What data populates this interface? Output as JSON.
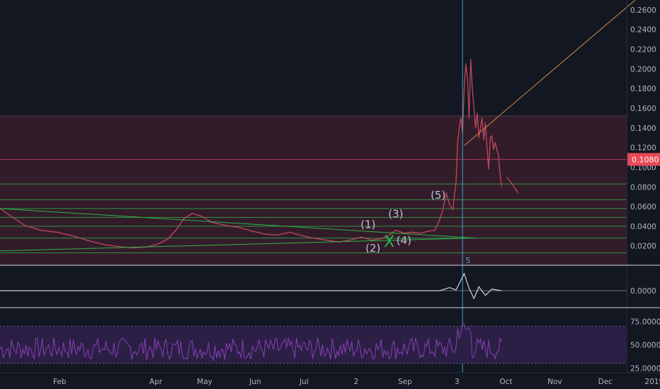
{
  "colors": {
    "background": "#131722",
    "axis_text": "#b2b5be",
    "price_line": "#c2485e",
    "last_price_label_bg": "#e84855",
    "green_lines": "#2eb24a",
    "trend_line": "#c98a4a",
    "vertical_marker": "#3fa2c6",
    "rsi_band": "#2b1f45",
    "rsi_line": "#8a3fb8",
    "resistance_zone": "#3a1d2b"
  },
  "chart_data": [
    {
      "type": "line",
      "panel": "price",
      "ylim": [
        0.004,
        0.27
      ],
      "ytick_labels": [
        "0.2600",
        "0.2400",
        "0.2200",
        "0.2000",
        "0.1800",
        "0.1600",
        "0.1400",
        "0.1200",
        "0.1000",
        "0.0800",
        "0.0600",
        "0.0400",
        "0.0200"
      ],
      "ytick_values": [
        0.26,
        0.24,
        0.22,
        0.2,
        0.18,
        0.16,
        0.14,
        0.12,
        0.1,
        0.08,
        0.06,
        0.04,
        0.02
      ],
      "last_price_label": "0.1080",
      "last_price": 0.108,
      "xtick_labels": [
        "Feb",
        "Apr",
        "May",
        "Jun",
        "Jul",
        "2",
        "Sep",
        "3",
        "Oct",
        "Nov",
        "Dec",
        "2019",
        "Feb"
      ],
      "xtick_days": [
        31,
        90,
        120,
        151,
        181,
        213,
        243,
        275,
        305,
        335,
        366,
        396,
        427
      ],
      "series": [
        {
          "points": [
            {
              "x": 0,
              "y": 0.058
            },
            {
              "x": 8,
              "y": 0.049
            },
            {
              "x": 15,
              "y": 0.041
            },
            {
              "x": 25,
              "y": 0.036
            },
            {
              "x": 35,
              "y": 0.034
            },
            {
              "x": 45,
              "y": 0.03
            },
            {
              "x": 55,
              "y": 0.025
            },
            {
              "x": 65,
              "y": 0.021
            },
            {
              "x": 75,
              "y": 0.019
            },
            {
              "x": 82,
              "y": 0.018
            },
            {
              "x": 90,
              "y": 0.019
            },
            {
              "x": 97,
              "y": 0.022
            },
            {
              "x": 103,
              "y": 0.027
            },
            {
              "x": 108,
              "y": 0.036
            },
            {
              "x": 113,
              "y": 0.048
            },
            {
              "x": 118,
              "y": 0.053
            },
            {
              "x": 124,
              "y": 0.05
            },
            {
              "x": 130,
              "y": 0.044
            },
            {
              "x": 138,
              "y": 0.041
            },
            {
              "x": 146,
              "y": 0.039
            },
            {
              "x": 155,
              "y": 0.035
            },
            {
              "x": 163,
              "y": 0.032
            },
            {
              "x": 170,
              "y": 0.031
            },
            {
              "x": 178,
              "y": 0.034
            },
            {
              "x": 184,
              "y": 0.031
            },
            {
              "x": 192,
              "y": 0.028
            },
            {
              "x": 200,
              "y": 0.026
            },
            {
              "x": 208,
              "y": 0.024
            },
            {
              "x": 215,
              "y": 0.026
            },
            {
              "x": 222,
              "y": 0.029
            },
            {
              "x": 228,
              "y": 0.026
            },
            {
              "x": 233,
              "y": 0.027
            },
            {
              "x": 238,
              "y": 0.03
            },
            {
              "x": 243,
              "y": 0.036
            },
            {
              "x": 248,
              "y": 0.033
            },
            {
              "x": 253,
              "y": 0.034
            },
            {
              "x": 258,
              "y": 0.033
            },
            {
              "x": 263,
              "y": 0.035
            },
            {
              "x": 267,
              "y": 0.036
            },
            {
              "x": 270,
              "y": 0.047
            },
            {
              "x": 272,
              "y": 0.057
            },
            {
              "x": 274,
              "y": 0.074
            },
            {
              "x": 276,
              "y": 0.062
            },
            {
              "x": 278,
              "y": 0.057
            },
            {
              "x": 280,
              "y": 0.085
            },
            {
              "x": 281,
              "y": 0.125
            },
            {
              "x": 282,
              "y": 0.14
            },
            {
              "x": 283,
              "y": 0.15
            },
            {
              "x": 284,
              "y": 0.135
            },
            {
              "x": 285,
              "y": 0.18
            },
            {
              "x": 286,
              "y": 0.205
            },
            {
              "x": 287,
              "y": 0.19
            },
            {
              "x": 288,
              "y": 0.15
            },
            {
              "x": 289,
              "y": 0.21
            },
            {
              "x": 290,
              "y": 0.18
            },
            {
              "x": 291,
              "y": 0.16
            },
            {
              "x": 292,
              "y": 0.14
            },
            {
              "x": 293,
              "y": 0.155
            },
            {
              "x": 294,
              "y": 0.13
            },
            {
              "x": 296,
              "y": 0.15
            },
            {
              "x": 297,
              "y": 0.128
            },
            {
              "x": 298,
              "y": 0.145
            },
            {
              "x": 299,
              "y": 0.12
            },
            {
              "x": 300,
              "y": 0.098
            },
            {
              "x": 301,
              "y": 0.13
            },
            {
              "x": 302,
              "y": 0.132
            },
            {
              "x": 303,
              "y": 0.118
            },
            {
              "x": 304,
              "y": 0.125
            },
            {
              "x": 306,
              "y": 0.112
            },
            {
              "x": 307,
              "y": 0.093
            },
            {
              "x": 308,
              "y": 0.08
            }
          ]
        },
        {
          "name": "",
          "points": [
            {
              "x": 311,
              "y": 0.09
            },
            {
              "x": 314,
              "y": 0.084
            },
            {
              "x": 318,
              "y": 0.074
            }
          ]
        }
      ],
      "horizontal_levels": [
        0.108,
        0.083,
        0.067,
        0.058,
        0.049,
        0.04,
        0.028,
        0.013
      ],
      "resistance_zone": [
        0.0,
        0.152
      ],
      "vertical_marker_x": 284,
      "vertical_marker_label": "5",
      "trend_lines": [
        {
          "from": {
            "x": 0,
            "y": 0.058
          },
          "to": {
            "x": 292,
            "y": 0.028
          }
        },
        {
          "from": {
            "x": 0,
            "y": 0.015
          },
          "to": {
            "x": 290,
            "y": 0.028
          }
        },
        {
          "from": {
            "x": 285,
            "y": 0.122
          },
          "to": {
            "x": 390,
            "y": 0.27
          }
        }
      ],
      "wave_labels": [
        {
          "label": "(1)",
          "x": 226,
          "y": 0.038
        },
        {
          "label": "(2)",
          "x": 229,
          "y": 0.014
        },
        {
          "label": "(3)",
          "x": 243,
          "y": 0.049
        },
        {
          "label": "(4)",
          "x": 248,
          "y": 0.022
        },
        {
          "label": "(5)",
          "x": 269,
          "y": 0.068
        },
        {
          "label": "X",
          "x": 239,
          "y": 0.019
        }
      ]
    },
    {
      "type": "line",
      "panel": "oscillator",
      "ytick_labels": [
        "0.0000"
      ],
      "ytick_values": [
        0
      ],
      "series": [
        {
          "points": [
            {
              "x": 0,
              "y": 0
            },
            {
              "x": 270,
              "y": 0
            },
            {
              "x": 276,
              "y": 0.4
            },
            {
              "x": 280,
              "y": 0.1
            },
            {
              "x": 285,
              "y": 2.2
            },
            {
              "x": 288,
              "y": 0.3
            },
            {
              "x": 291,
              "y": -1.0
            },
            {
              "x": 294,
              "y": 0.5
            },
            {
              "x": 298,
              "y": -0.6
            },
            {
              "x": 302,
              "y": 0.2
            },
            {
              "x": 308,
              "y": 0
            }
          ]
        }
      ]
    },
    {
      "type": "line",
      "panel": "rsi",
      "ylim": [
        20,
        90
      ],
      "band": [
        30,
        70
      ],
      "ytick_labels": [
        "75.0000",
        "50.0000",
        "25.0000"
      ],
      "ytick_values": [
        75,
        50,
        25
      ]
    }
  ]
}
